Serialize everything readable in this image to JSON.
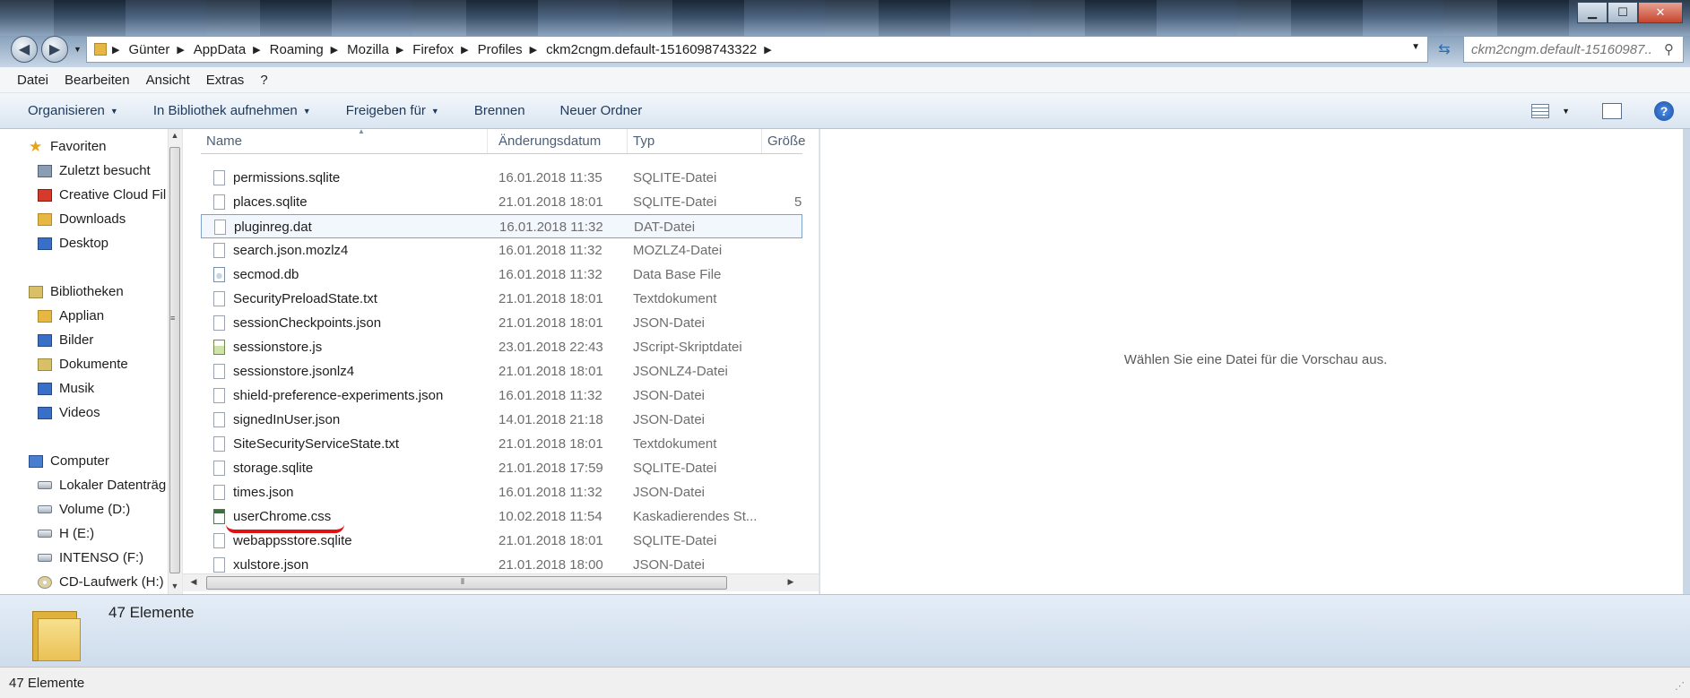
{
  "window": {
    "minimize": "▁",
    "maximize": "☐",
    "close": "✕"
  },
  "nav": {
    "back_icon": "◀",
    "forward_icon": "▶"
  },
  "address": {
    "breadcrumbs": [
      "Günter",
      "AppData",
      "Roaming",
      "Mozilla",
      "Firefox",
      "Profiles",
      "ckm2cngm.default-1516098743322"
    ]
  },
  "search": {
    "placeholder": "ckm2cngm.default-15160987..."
  },
  "menu": [
    "Datei",
    "Bearbeiten",
    "Ansicht",
    "Extras",
    "?"
  ],
  "commands": {
    "organize": "Organisieren",
    "library": "In Bibliothek aufnehmen",
    "share": "Freigeben für",
    "burn": "Brennen",
    "new_folder": "Neuer Ordner"
  },
  "sidebar": {
    "favorites": "Favoriten",
    "recent": "Zuletzt besucht",
    "creative_cloud": "Creative Cloud Fil",
    "downloads": "Downloads",
    "desktop": "Desktop",
    "libraries": "Bibliotheken",
    "applian": "Applian",
    "pictures": "Bilder",
    "documents": "Dokumente",
    "music": "Musik",
    "videos": "Videos",
    "computer": "Computer",
    "local_disk": "Lokaler Datenträg",
    "volume_d": "Volume (D:)",
    "h_e": "H (E:)",
    "intenso": "INTENSO (F:)",
    "cd": "CD-Laufwerk (H:)"
  },
  "columns": {
    "name": "Name",
    "date": "Änderungsdatum",
    "type": "Typ",
    "size": "Größe"
  },
  "files": [
    {
      "name": "permissions.sqlite",
      "date": "16.01.2018 11:35",
      "type": "SQLITE-Datei",
      "size": ""
    },
    {
      "name": "places.sqlite",
      "date": "21.01.2018 18:01",
      "type": "SQLITE-Datei",
      "size": "5"
    },
    {
      "name": "pluginreg.dat",
      "date": "16.01.2018 11:32",
      "type": "DAT-Datei",
      "size": ""
    },
    {
      "name": "search.json.mozlz4",
      "date": "16.01.2018 11:32",
      "type": "MOZLZ4-Datei",
      "size": ""
    },
    {
      "name": "secmod.db",
      "date": "16.01.2018 11:32",
      "type": "Data Base File",
      "size": ""
    },
    {
      "name": "SecurityPreloadState.txt",
      "date": "21.01.2018 18:01",
      "type": "Textdokument",
      "size": ""
    },
    {
      "name": "sessionCheckpoints.json",
      "date": "21.01.2018 18:01",
      "type": "JSON-Datei",
      "size": ""
    },
    {
      "name": "sessionstore.js",
      "date": "23.01.2018 22:43",
      "type": "JScript-Skriptdatei",
      "size": ""
    },
    {
      "name": "sessionstore.jsonlz4",
      "date": "21.01.2018 18:01",
      "type": "JSONLZ4-Datei",
      "size": ""
    },
    {
      "name": "shield-preference-experiments.json",
      "date": "16.01.2018 11:32",
      "type": "JSON-Datei",
      "size": ""
    },
    {
      "name": "signedInUser.json",
      "date": "14.01.2018 21:18",
      "type": "JSON-Datei",
      "size": ""
    },
    {
      "name": "SiteSecurityServiceState.txt",
      "date": "21.01.2018 18:01",
      "type": "Textdokument",
      "size": ""
    },
    {
      "name": "storage.sqlite",
      "date": "21.01.2018 17:59",
      "type": "SQLITE-Datei",
      "size": ""
    },
    {
      "name": "times.json",
      "date": "16.01.2018 11:32",
      "type": "JSON-Datei",
      "size": ""
    },
    {
      "name": "userChrome.css",
      "date": "10.02.2018 11:54",
      "type": "Kaskadierendes St...",
      "size": ""
    },
    {
      "name": "webappsstore.sqlite",
      "date": "21.01.2018 18:01",
      "type": "SQLITE-Datei",
      "size": ""
    },
    {
      "name": "xulstore.json",
      "date": "21.01.2018 18:00",
      "type": "JSON-Datei",
      "size": ""
    }
  ],
  "preview": {
    "text": "Wählen Sie eine Datei für die Vorschau aus."
  },
  "details": {
    "count": "47 Elemente"
  },
  "status": {
    "text": "47 Elemente"
  },
  "colors": {
    "annotation_red": "#e11111",
    "selection_border": "#7da2ce"
  }
}
